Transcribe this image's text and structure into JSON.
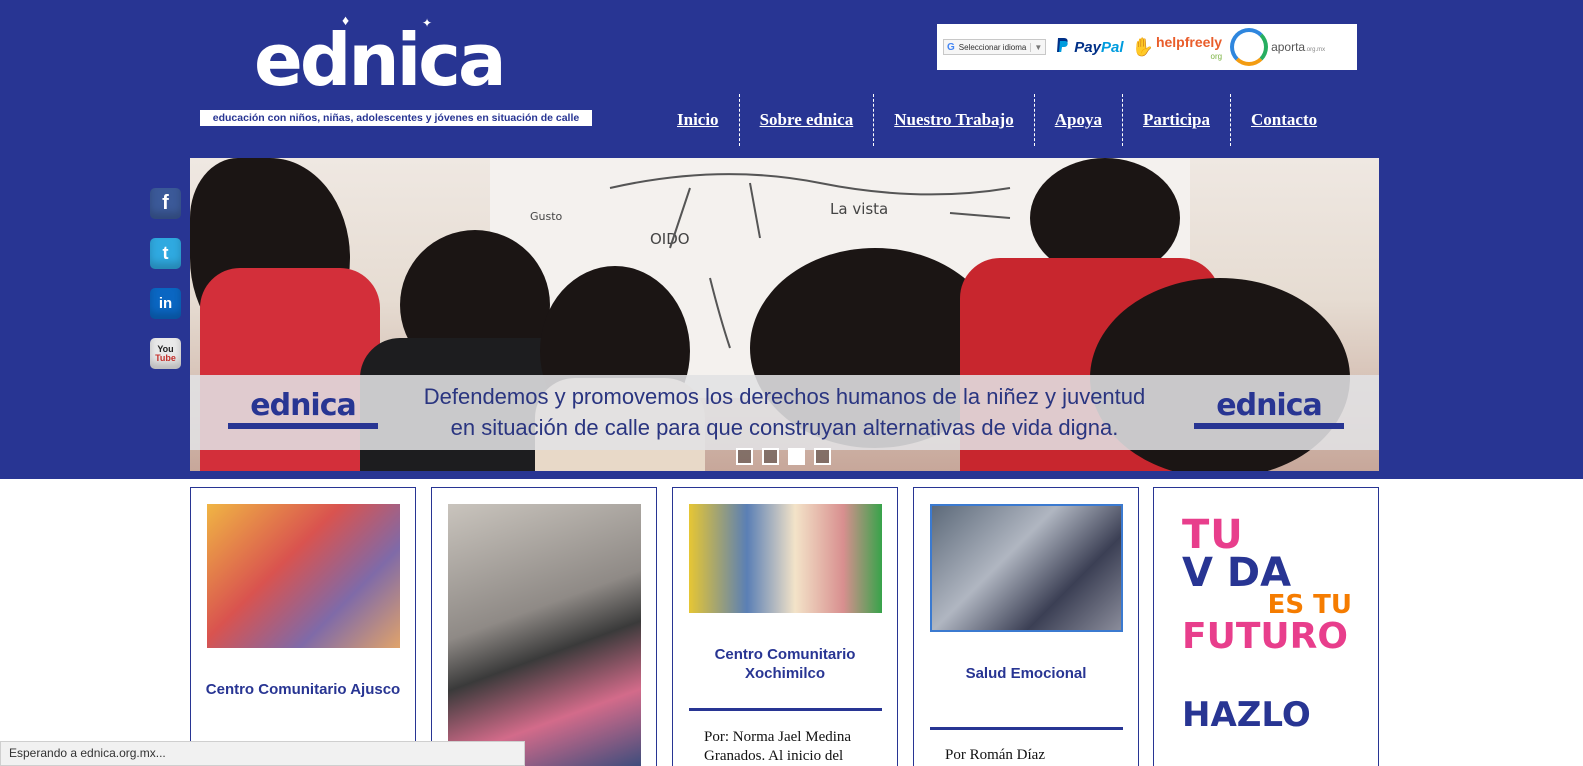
{
  "header": {
    "logo_word": "ednica",
    "tagline": "educación con niños, niñas, adolescentes y jóvenes en situación de calle"
  },
  "translate": {
    "label": "Seleccionar idioma",
    "g": "G",
    "caret": "▼"
  },
  "donate": {
    "paypal_pay": "Pay",
    "paypal_pal": "Pal",
    "helpfreely": "helpfreely",
    "helpfreely_org": "org",
    "aporta": "aporta",
    "aporta_domain": ".org.mx"
  },
  "nav": {
    "items": [
      {
        "label": "Inicio"
      },
      {
        "label": "Sobre ednica"
      },
      {
        "label": "Nuestro Trabajo"
      },
      {
        "label": "Apoya"
      },
      {
        "label": "Participa"
      },
      {
        "label": "Contacto"
      }
    ]
  },
  "social": {
    "facebook": "f",
    "twitter": "t",
    "linkedin": "in",
    "youtube_you": "You",
    "youtube_tube": "Tube"
  },
  "hero": {
    "line1": "Defendemos y promovemos los derechos humanos de la niñez y juventud",
    "line2": "en situación de calle para que construyan alternativas de vida digna.",
    "banner_logo": "ednica",
    "whiteboard_text_1": "La vista",
    "whiteboard_text_2": "OIDO",
    "whiteboard_text_3": "Gusto",
    "slides": 4,
    "active_slide": 3
  },
  "cards": [
    {
      "title": "Centro Comunitario Ajusco"
    },
    {
      "title": ""
    },
    {
      "title": "Centro Comunitario Xochimilco",
      "excerpt": "Por: Norma Jael Medina Granados. Al inicio del"
    },
    {
      "title": "Salud Emocional",
      "excerpt": "Por Román Díaz"
    },
    {
      "poster_1": "TU",
      "poster_2": "V  DA",
      "poster_3": "ES TU",
      "poster_4": "FUTURO",
      "poster_5": "HAZLO"
    }
  ],
  "status_bar": "Esperando a ednica.org.mx..."
}
